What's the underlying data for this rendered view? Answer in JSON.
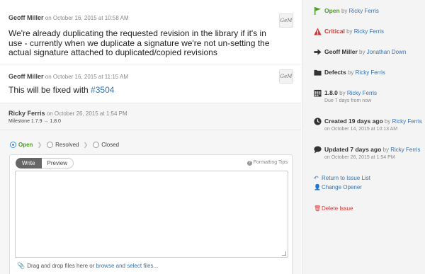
{
  "comments": [
    {
      "author": "Geoff Miller",
      "date": "on October 16, 2015 at 10:58 AM",
      "avatar": "GeM",
      "body": "We're already duplicating the requested revision in the library if it's in use - currently when we duplicate a signature we're not un-setting the actual signature attached to duplicated/copied revisions"
    },
    {
      "author": "Geoff Miller",
      "date": "on October 16, 2015 at 11:15 AM",
      "avatar": "GeM",
      "body_prefix": "This will be fixed with ",
      "body_link": "#3504"
    }
  ],
  "status_change": {
    "author": "Ricky Ferris",
    "date": "on October 26, 2015 at 1:54 PM",
    "milestone_label": "Milestone",
    "milestone_value": "1.7.9 → 1.8.0"
  },
  "editor": {
    "statuses": [
      "Open",
      "Resolved",
      "Closed"
    ],
    "selected_status": "Open",
    "tabs": [
      "Write",
      "Preview"
    ],
    "formatting_tips": "Formatting Tips",
    "dropzone_text": "Drag and drop files here or ",
    "dropzone_link": "browse and select files..."
  },
  "sidebar": {
    "status": {
      "label": "Open",
      "by": "by",
      "user": "Ricky Ferris",
      "color": "#4a9a26",
      "icon": "flag-icon"
    },
    "priority": {
      "label": "Critical",
      "by": "by",
      "user": "Ricky Ferris",
      "color": "#d33333",
      "icon": "warning-icon"
    },
    "assignee": {
      "label": "Geoff Miller",
      "by": "by",
      "user": "Jonathan Down",
      "icon": "arrow-right-icon"
    },
    "category": {
      "label": "Defects",
      "by": "by",
      "user": "Ricky Ferris",
      "icon": "folder-icon"
    },
    "milestone": {
      "label": "1.8.0",
      "by": "by",
      "user": "Ricky Ferris",
      "sub": "Due 7 days from now",
      "icon": "calendar-icon"
    },
    "created": {
      "label": "Created 19 days ago",
      "by": "by",
      "user": "Ricky Ferris",
      "sub": "on October 14, 2015 at 10:13 AM",
      "icon": "clock-icon"
    },
    "updated": {
      "label": "Updated 7 days ago",
      "by": "by",
      "user": "Ricky Ferris",
      "sub": "on October 26, 2015 at 1:54 PM",
      "icon": "speech-bubble-icon"
    },
    "links": {
      "return": "Return to Issue List",
      "change_opener": "Change Opener",
      "delete": "Delete Issue"
    }
  }
}
